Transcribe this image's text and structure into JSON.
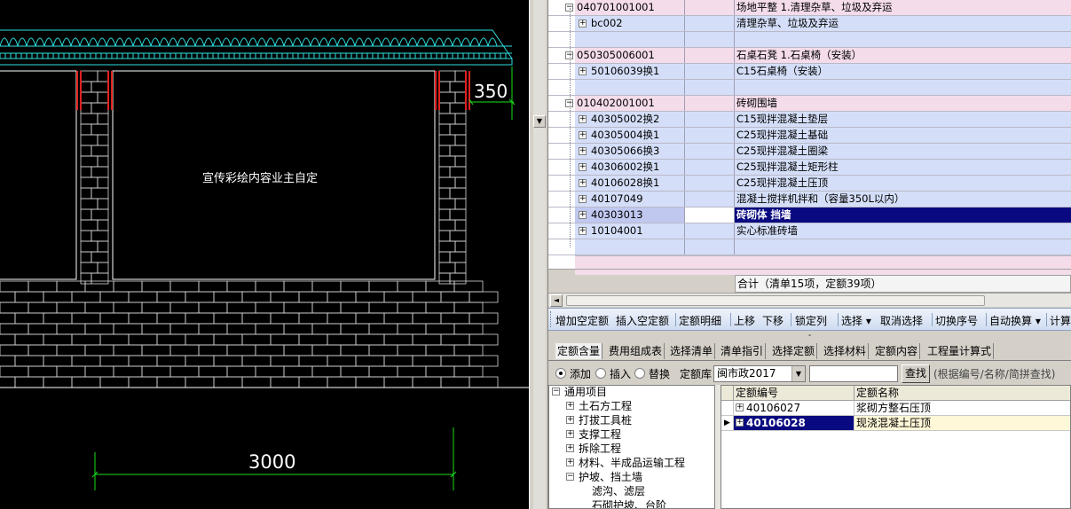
{
  "cad": {
    "panel_note": "宣传彩绘内容业主自定",
    "dim_right": "350",
    "dim_bottom": "3000",
    "colors": {
      "roof": "#2fe0e0",
      "brick": "#d8d8d8",
      "dimension": "#19e019",
      "post": "#e02020"
    }
  },
  "grid": {
    "rows": [
      {
        "code": "040701001001",
        "name": "场地平整    1.清理杂草、垃圾及弃运",
        "kind": "pink",
        "expander": "−",
        "level": 0
      },
      {
        "code": "bc002",
        "name": "清理杂草、垃圾及弃运",
        "kind": "blue",
        "expander": "+",
        "level": 1
      },
      {
        "code": "",
        "name": "",
        "kind": "blue",
        "expander": "",
        "level": 1
      },
      {
        "code": "050305006001",
        "name": "石桌石凳    1.石桌椅（安装）",
        "kind": "pink",
        "expander": "−",
        "level": 0
      },
      {
        "code": "50106039换1",
        "name": "C15石桌椅（安装）",
        "kind": "blue",
        "expander": "+",
        "level": 1
      },
      {
        "code": "",
        "name": "",
        "kind": "blue",
        "expander": "",
        "level": 1
      },
      {
        "code": "010402001001",
        "name": "砖砌围墙",
        "kind": "pink",
        "expander": "−",
        "level": 0
      },
      {
        "code": "40305002换2",
        "name": "C15现拌混凝土垫层",
        "kind": "blue",
        "expander": "+",
        "level": 1
      },
      {
        "code": "40305004换1",
        "name": "C25现拌混凝土基础",
        "kind": "blue",
        "expander": "+",
        "level": 1
      },
      {
        "code": "40305066换3",
        "name": "C25现拌混凝土圈梁",
        "kind": "blue",
        "expander": "+",
        "level": 1
      },
      {
        "code": "40306002换1",
        "name": "C25现拌混凝土矩形柱",
        "kind": "blue",
        "expander": "+",
        "level": 1
      },
      {
        "code": "40106028换1",
        "name": "C25现拌混凝土压顶",
        "kind": "blue",
        "expander": "+",
        "level": 1
      },
      {
        "code": "40107049",
        "name": "混凝土搅拌机拌和（容量350L以内）",
        "kind": "blue",
        "expander": "+",
        "level": 1
      },
      {
        "code": "40303013",
        "name": "砖砌体  挡墙",
        "kind": "sel",
        "expander": "+",
        "level": 1
      },
      {
        "code": "10104001",
        "name": "实心标准砖墙",
        "kind": "blue",
        "expander": "+",
        "level": 1
      },
      {
        "code": "",
        "name": "",
        "kind": "blue",
        "expander": "",
        "level": 1
      }
    ],
    "summary": "合计（清单15项，定额39项）"
  },
  "toolbar": {
    "items": [
      "增加空定额",
      "插入空定额",
      "定额明细",
      "上移",
      "下移",
      "锁定列",
      "选择 ▾",
      "取消选择",
      "切换序号",
      "自动换算 ▾",
      "计算"
    ]
  },
  "tabs": [
    "定额含量",
    "费用组成表",
    "选择清单",
    "清单指引",
    "选择定额",
    "选择材料",
    "定额内容",
    "工程量计算式"
  ],
  "options": {
    "add": "添加",
    "insert": "插入",
    "replace": "替换",
    "library_label": "定额库",
    "library_value": "闽市政2017",
    "find_button": "查找",
    "find_hint": "(根据编号/名称/简拼查找)"
  },
  "tree": {
    "root": "通用项目",
    "children": [
      "土石方工程",
      "打拔工具桩",
      "支撑工程",
      "拆除工程",
      "材料、半成品运输工程",
      "护坡、挡土墙"
    ],
    "grandchildren": [
      "滤沟、滤层",
      "石砌护坡、台阶"
    ]
  },
  "quota": {
    "header": {
      "code": "定额编号",
      "name": "定额名称"
    },
    "rows": [
      {
        "code": "40106027",
        "name": "浆砌方整石压顶",
        "selected": false
      },
      {
        "code": "40106028",
        "name": "现浇混凝土压顶",
        "selected": true
      }
    ]
  }
}
